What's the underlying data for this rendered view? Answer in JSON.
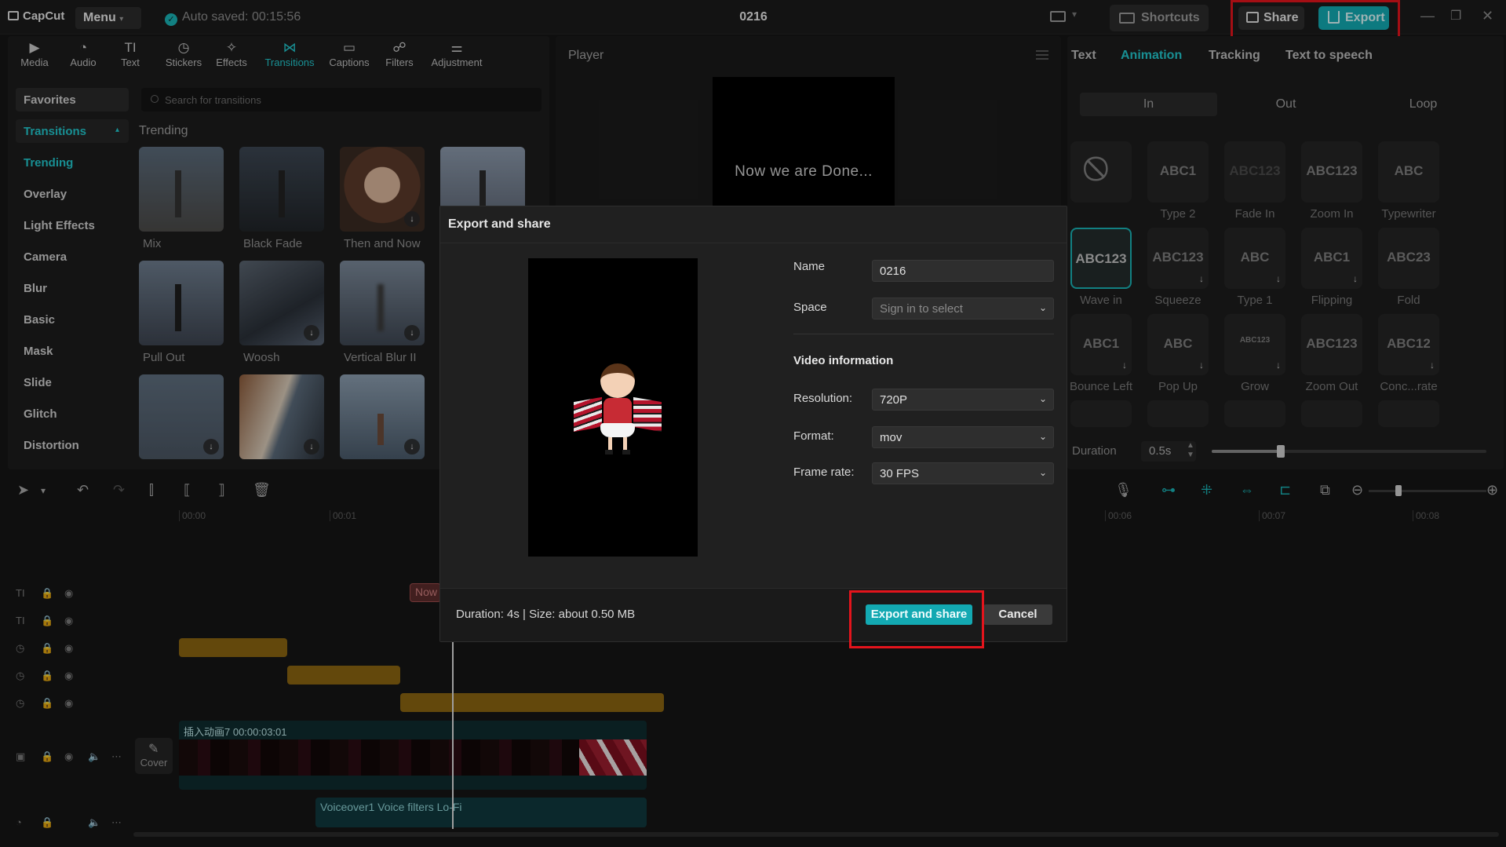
{
  "app": {
    "logo_text": "CapCut",
    "menu_label": "Menu",
    "autosave": "Auto saved: 00:15:56",
    "project_title": "0216",
    "shortcuts_label": "Shortcuts",
    "share_label": "Share",
    "export_label": "Export",
    "accent_color": "#13a9b2"
  },
  "tool_tabs": [
    {
      "label": "Media",
      "icon": "media-icon"
    },
    {
      "label": "Audio",
      "icon": "audio-icon"
    },
    {
      "label": "Text",
      "icon": "text-icon"
    },
    {
      "label": "Stickers",
      "icon": "stickers-icon"
    },
    {
      "label": "Effects",
      "icon": "effects-icon"
    },
    {
      "label": "Transitions",
      "icon": "transitions-icon",
      "active": true
    },
    {
      "label": "Captions",
      "icon": "captions-icon"
    },
    {
      "label": "Filters",
      "icon": "filters-icon"
    },
    {
      "label": "Adjustment",
      "icon": "adjustment-icon"
    }
  ],
  "categories": [
    "Favorites",
    "Transitions",
    "Trending",
    "Overlay",
    "Light Effects",
    "Camera",
    "Blur",
    "Basic",
    "Mask",
    "Slide",
    "Glitch",
    "Distortion"
  ],
  "search": {
    "placeholder": "Search for transitions"
  },
  "trending_label": "Trending",
  "thumbnails": [
    "Mix",
    "Black Fade",
    "Then and Now",
    "Pull Out",
    "Woosh",
    "Vertical Blur II"
  ],
  "player": {
    "title": "Player",
    "overlay_text": "Now we are Done..."
  },
  "right_panel": {
    "tabs": [
      "Text",
      "Animation",
      "Tracking",
      "Text to speech"
    ],
    "segments": [
      "In",
      "Out",
      "Loop"
    ],
    "animations": [
      {
        "preview": "⃠",
        "label": ""
      },
      {
        "preview": "ABC1",
        "label": "Type 2"
      },
      {
        "preview": "ABC123",
        "label": "Fade In"
      },
      {
        "preview": "ABC123",
        "label": "Zoom In"
      },
      {
        "preview": "ABC",
        "label": "Typewriter"
      },
      {
        "preview": "ABC123",
        "label": "Wave in"
      },
      {
        "preview": "ABC123",
        "label": "Squeeze"
      },
      {
        "preview": "ABC",
        "label": "Type 1"
      },
      {
        "preview": "ABC1",
        "label": "Flipping"
      },
      {
        "preview": "ABC23",
        "label": "Fold"
      },
      {
        "preview": "ABC1",
        "label": "Bounce Left"
      },
      {
        "preview": "ABC",
        "label": "Pop Up"
      },
      {
        "preview": "ABC123",
        "label": "Grow"
      },
      {
        "preview": "ABC123",
        "label": "Zoom Out"
      },
      {
        "preview": "ABC12",
        "label": "Conc...rate"
      }
    ],
    "duration_label": "Duration",
    "duration_value": "0.5s",
    "duration_fraction": 0.25
  },
  "timeline": {
    "ruler": [
      "00:00",
      "00:01",
      "00:06",
      "00:07",
      "00:08"
    ],
    "text_clip": "Now",
    "video_clip_label": "插入动画7  00:00:03:01",
    "audio_clip_label": "Voiceover1   Voice filters Lo-Fi",
    "cover_label": "Cover"
  },
  "dialog": {
    "title": "Export and share",
    "name_label": "Name",
    "name_value": "0216",
    "space_label": "Space",
    "space_placeholder": "Sign in to select",
    "video_info_label": "Video information",
    "resolution_label": "Resolution:",
    "resolution_value": "720P",
    "format_label": "Format:",
    "format_value": "mov",
    "framerate_label": "Frame rate:",
    "framerate_value": "30 FPS",
    "summary": "Duration: 4s | Size: about 0.50 MB",
    "export_button": "Export and share",
    "cancel_button": "Cancel"
  }
}
